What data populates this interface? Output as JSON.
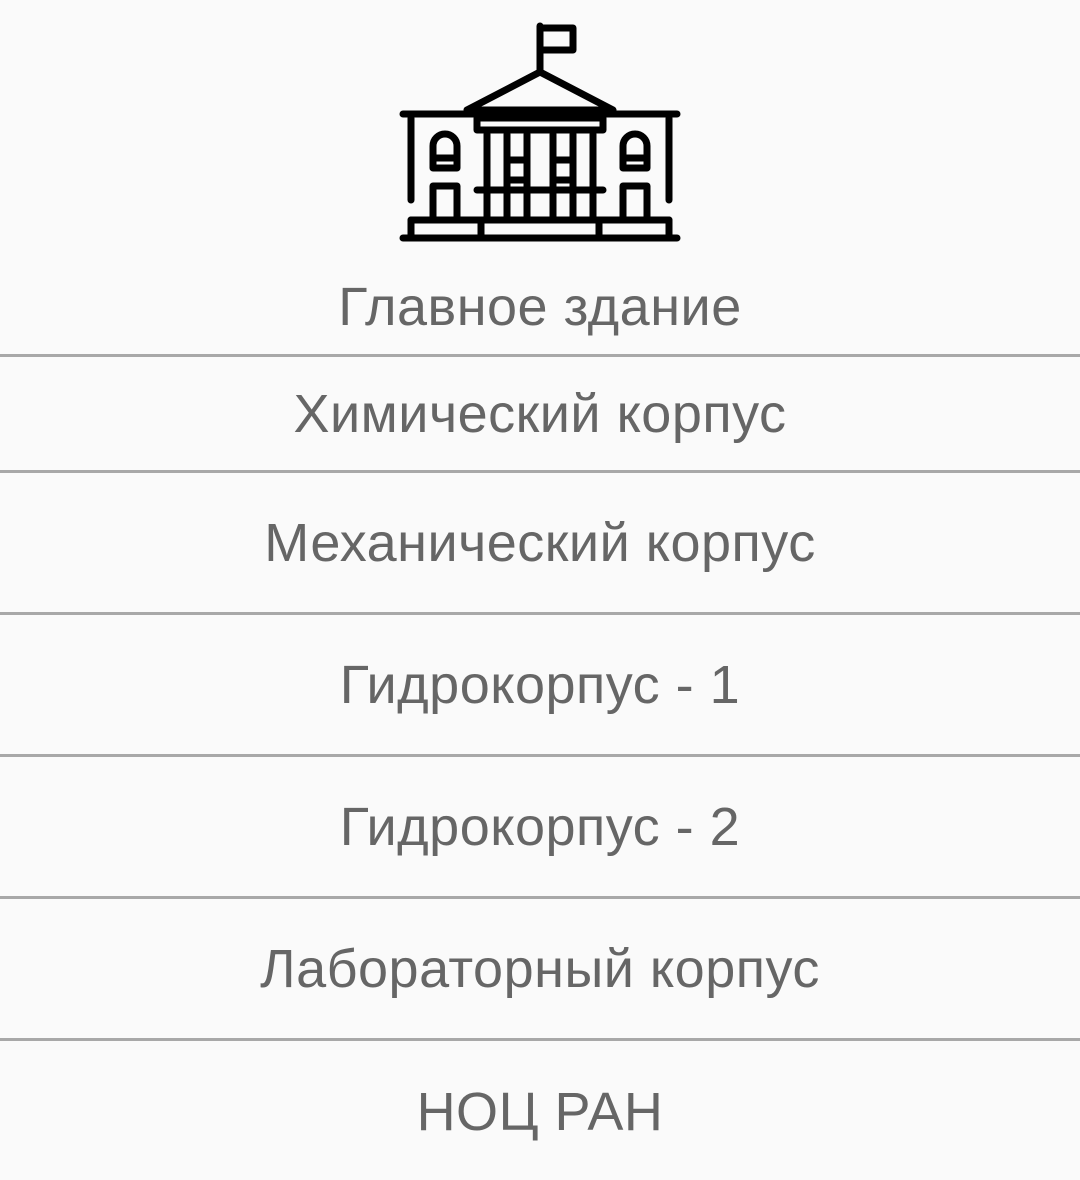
{
  "header": {
    "icon": "government-building-icon"
  },
  "buildings": [
    {
      "label": "Главное здание"
    },
    {
      "label": "Химический корпус"
    },
    {
      "label": "Механический корпус"
    },
    {
      "label": "Гидрокорпус - 1"
    },
    {
      "label": "Гидрокорпус - 2"
    },
    {
      "label": "Лабораторный корпус"
    },
    {
      "label": "НОЦ РАН"
    }
  ],
  "colors": {
    "background": "#fafafa",
    "text": "#666666",
    "divider": "#a8a8a8",
    "icon": "#000000"
  }
}
